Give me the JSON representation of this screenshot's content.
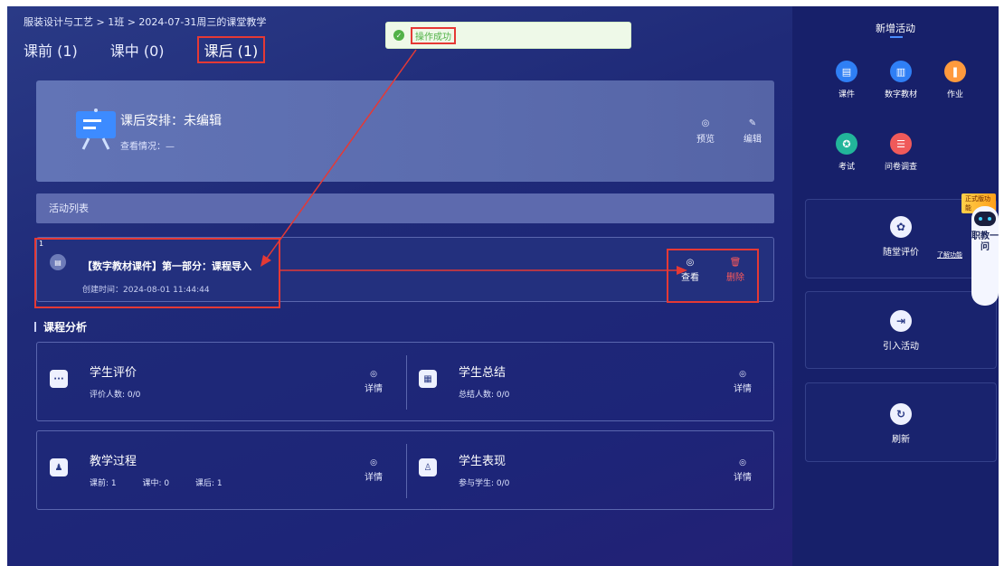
{
  "breadcrumb": "服装设计与工艺 > 1班 > 2024-07-31周三的课堂教学",
  "tabs": [
    {
      "label": "课前 (1)"
    },
    {
      "label": "课中 (0)"
    },
    {
      "label": "课后 (1)",
      "active": true
    }
  ],
  "toast": {
    "text": "操作成功",
    "icon": "check-circle-icon"
  },
  "plan": {
    "title": "课后安排：未编辑",
    "status": "查看情况：—",
    "preview_label": "预览",
    "edit_label": "编辑"
  },
  "activity_list": {
    "header": "活动列表",
    "items": [
      {
        "index": "1",
        "title": "【数字教材课件】第一部分：课程导入",
        "created": "创建时间：2024-08-01 11:44:44",
        "view_label": "查看",
        "delete_label": "删除"
      }
    ]
  },
  "analysis": {
    "title": "课程分析",
    "cards": [
      {
        "title": "学生评价",
        "sub": "评价人数: 0/0",
        "detail": "详情"
      },
      {
        "title": "学生总结",
        "sub": "总结人数: 0/0",
        "detail": "详情"
      },
      {
        "title": "教学过程",
        "sub_items": [
          "课前: 1",
          "课中: 0",
          "课后: 1"
        ],
        "detail": "详情"
      },
      {
        "title": "学生表现",
        "sub": "参与学生: 0/0",
        "detail": "详情"
      }
    ]
  },
  "sidebar": {
    "title": "新增活动",
    "tools": [
      {
        "label": "课件",
        "color": "#2f7ff5"
      },
      {
        "label": "数字教材",
        "color": "#2f7ff5"
      },
      {
        "label": "作业",
        "color": "#ff9a3d"
      },
      {
        "label": "考试",
        "color": "#22b59a"
      },
      {
        "label": "问卷调查",
        "color": "#f05a5a"
      }
    ],
    "classroom_eval": {
      "label": "随堂评价",
      "link": "了解功能",
      "badge": "正式版功能"
    },
    "import_label": "引入活动",
    "refresh_label": "刷新"
  },
  "assistant": {
    "text": "职教一问"
  },
  "colors": {
    "highlight": "#e53935",
    "toast_green": "#52b248",
    "delete_red": "#ff5a5a"
  }
}
